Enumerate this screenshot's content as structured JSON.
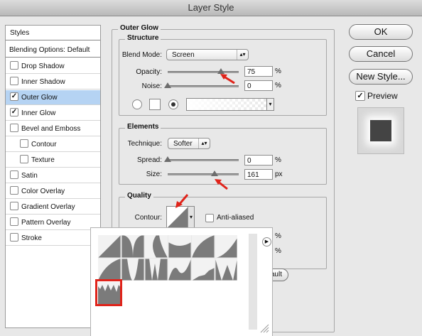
{
  "window": {
    "title": "Layer Style"
  },
  "sidebar": {
    "items": [
      {
        "label": "Styles"
      },
      {
        "label": "Blending Options: Default"
      },
      {
        "label": "Drop Shadow",
        "checked": false
      },
      {
        "label": "Inner Shadow",
        "checked": false
      },
      {
        "label": "Outer Glow",
        "checked": true
      },
      {
        "label": "Inner Glow",
        "checked": true
      },
      {
        "label": "Bevel and Emboss",
        "checked": false
      },
      {
        "label": "Contour",
        "checked": false
      },
      {
        "label": "Texture",
        "checked": false
      },
      {
        "label": "Satin",
        "checked": false
      },
      {
        "label": "Color Overlay",
        "checked": false
      },
      {
        "label": "Gradient Overlay",
        "checked": false
      },
      {
        "label": "Pattern Overlay",
        "checked": false
      },
      {
        "label": "Stroke",
        "checked": false
      }
    ],
    "selected_color": "#b5d3f3"
  },
  "outer_glow": {
    "title": "Outer Glow",
    "structure": {
      "title": "Structure",
      "blend_mode_label": "Blend Mode:",
      "blend_mode_value": "Screen",
      "opacity_label": "Opacity:",
      "opacity_value": "75",
      "opacity_unit": "%",
      "opacity_fraction": 0.75,
      "noise_label": "Noise:",
      "noise_value": "0",
      "noise_unit": "%",
      "noise_fraction": 0
    },
    "elements": {
      "title": "Elements",
      "technique_label": "Technique:",
      "technique_value": "Softer",
      "spread_label": "Spread:",
      "spread_value": "0",
      "spread_unit": "%",
      "size_label": "Size:",
      "size_value": "161",
      "size_unit": "px"
    },
    "quality": {
      "title": "Quality",
      "contour_label": "Contour:",
      "anti_aliased_label": "Anti-aliased",
      "anti_aliased": false,
      "range_unit": "%",
      "jitter_unit": "%"
    }
  },
  "buttons": {
    "ok": "OK",
    "cancel": "Cancel",
    "new_style": "New Style...",
    "preview_label": "Preview",
    "preview_checked": true,
    "reset_partial": "ault"
  },
  "colors": {
    "annotation_red": "#e0231a",
    "accent_blue": "#4a8fe0"
  }
}
